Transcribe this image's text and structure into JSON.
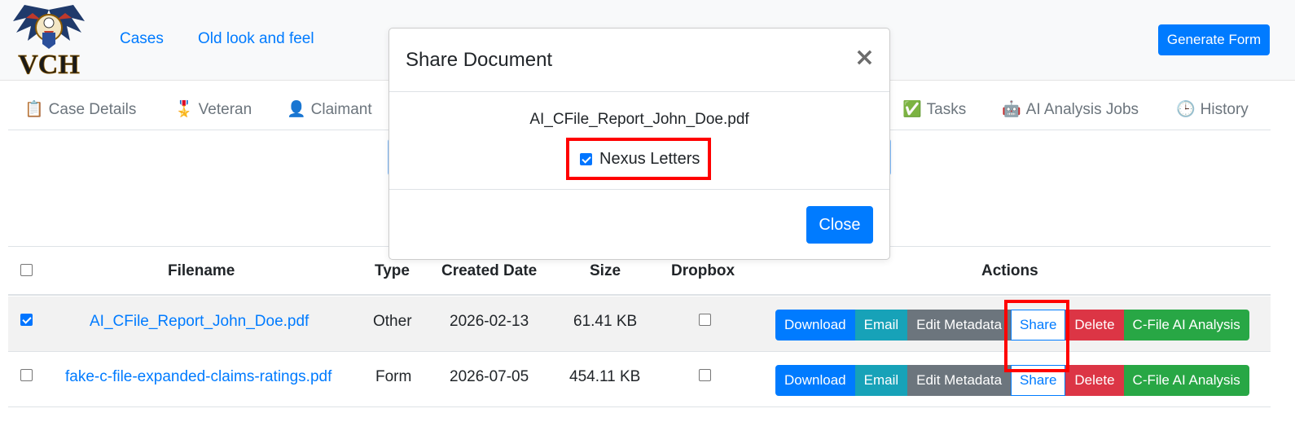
{
  "brand": {
    "logo_text": "VCH"
  },
  "nav": {
    "links": [
      "Cases",
      "Old look and feel"
    ],
    "generate_form": "Generate Form"
  },
  "tabs": [
    {
      "icon": "📋",
      "label": "Case Details"
    },
    {
      "icon": "🎖️",
      "label": "Veteran"
    },
    {
      "icon": "👤",
      "label": "Claimant"
    },
    {
      "icon": "✅",
      "label": "Tasks"
    },
    {
      "icon": "🤖",
      "label": "AI Analysis Jobs"
    },
    {
      "icon": "🕒",
      "label": "History"
    }
  ],
  "table": {
    "headers": [
      "Filename",
      "Type",
      "Created Date",
      "Size",
      "Dropbox",
      "Actions"
    ],
    "rows": [
      {
        "filename": "AI_CFile_Report_John_Doe.pdf",
        "type": "Other",
        "created": "2026-02-13",
        "size": "61.41 KB",
        "selected": true
      },
      {
        "filename": "fake-c-file-expanded-claims-ratings.pdf",
        "type": "Form",
        "created": "2026-07-05",
        "size": "454.11 KB",
        "selected": false
      }
    ],
    "actions": [
      "Download",
      "Email",
      "Edit Metadata",
      "Share",
      "Delete",
      "C-File AI Analysis"
    ]
  },
  "modal": {
    "title": "Share Document",
    "close_symbol": "×",
    "filename": "AI_CFile_Report_John_Doe.pdf",
    "option_label": "Nexus Letters",
    "close_button": "Close"
  },
  "colors": {
    "primary": "#007bff",
    "highlight": "#ff0000"
  }
}
